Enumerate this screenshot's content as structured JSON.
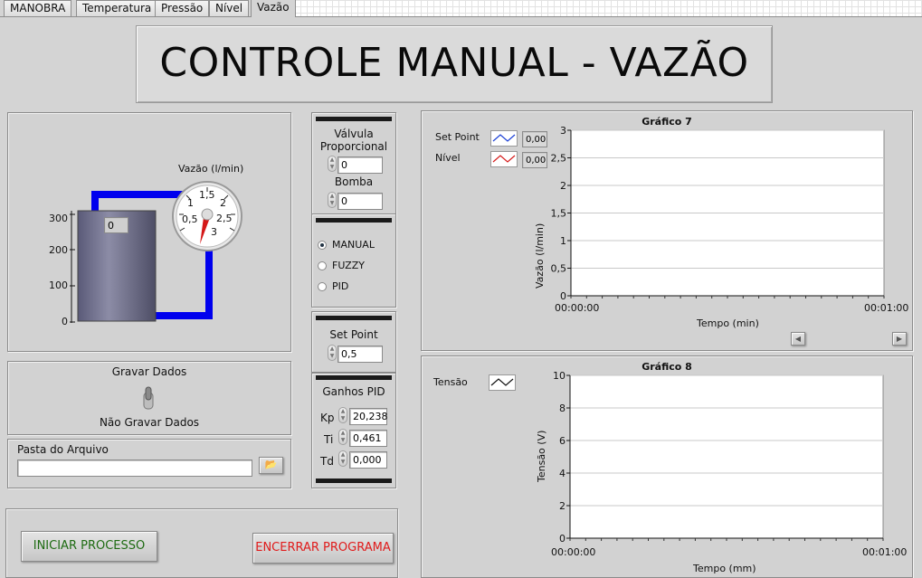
{
  "tabs": [
    "MANOBRA",
    "Temperatura",
    "Pressão",
    "Nível",
    "Vazão"
  ],
  "active_tab": "Vazão",
  "page_title": "CONTROLE MANUAL - VAZÃO",
  "tank": {
    "scale": [
      "300",
      "200",
      "100",
      "0"
    ],
    "value": "0",
    "gauge_label": "Vazão (l/min)",
    "gauge_ticks": [
      "1,5",
      "1",
      "2",
      "0,5",
      "2,5",
      "3"
    ]
  },
  "controls": {
    "valve_label": "Válvula Proporcional",
    "valve_value": "0",
    "pump_label": "Bomba",
    "pump_value": "0",
    "modes": [
      "MANUAL",
      "FUZZY",
      "PID"
    ],
    "selected_mode": "MANUAL",
    "setpoint_label": "Set Point",
    "setpoint_value": "0,5",
    "pid_title": "Ganhos PID",
    "kp_label": "Kp",
    "kp_value": "20,238",
    "ti_label": "Ti",
    "ti_value": "0,461",
    "td_label": "Td",
    "td_value": "0,000"
  },
  "record": {
    "title": "Gravar Dados",
    "state_label": "Não Gravar Dados"
  },
  "folder": {
    "label": "Pasta do Arquivo",
    "value": ""
  },
  "buttons": {
    "start": "INICIAR PROCESSO",
    "stop": "ENCERRAR PROGRAMA"
  },
  "colors": {
    "pipe": "#0000ee",
    "start_text": "#1e6b12",
    "stop_text": "#e01b1b"
  },
  "chart_data": [
    {
      "type": "line",
      "title": "Gráfico 7",
      "xlabel": "Tempo (min)",
      "ylabel": "Vazão (l/min)",
      "ylim": [
        0,
        3
      ],
      "yticks": [
        "3",
        "2,5",
        "2",
        "1,5",
        "1",
        "0,5",
        "0"
      ],
      "xticks": [
        "00:00:00",
        "00:01:00"
      ],
      "legend": [
        {
          "name": "Set Point",
          "value": "0,00",
          "color": "#1b3fd6"
        },
        {
          "name": "Nível",
          "value": "0,00",
          "color": "#d61b1b"
        }
      ],
      "series": []
    },
    {
      "type": "line",
      "title": "Gráfico 8",
      "xlabel": "Tempo (mm)",
      "ylabel": "Tensão (V)",
      "ylim": [
        0,
        10
      ],
      "yticks": [
        "10",
        "8",
        "6",
        "4",
        "2",
        "0"
      ],
      "xticks": [
        "00:00:00",
        "00:01:00"
      ],
      "legend": [
        {
          "name": "Tensão",
          "color": "#111111"
        }
      ],
      "series": []
    }
  ]
}
